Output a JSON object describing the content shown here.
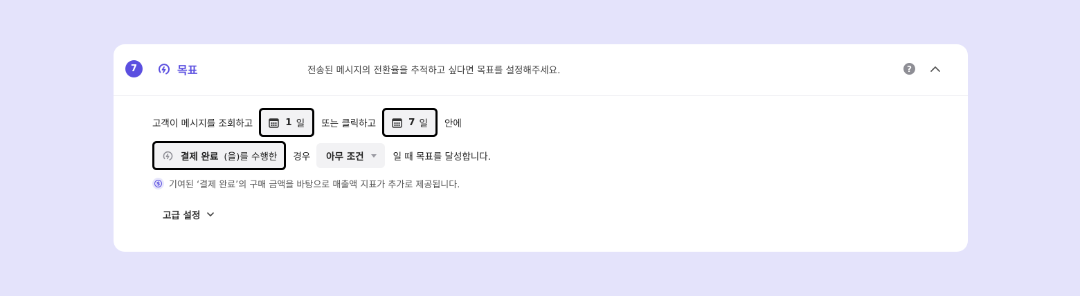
{
  "header": {
    "step_number": "7",
    "title": "목표",
    "description": "전송된 메시지의 전환율을 추적하고 싶다면 목표를 설정해주세요.",
    "help_label": "?"
  },
  "condition": {
    "prefix": "고객이 메시지를 조회하고",
    "view_days": "1",
    "day_unit": "일",
    "or_click": "또는 클릭하고",
    "click_days": "7",
    "within": "안에",
    "event_name": "결제 완료",
    "event_suffix": "(을)를 수행한",
    "case_label": "경우",
    "condition_value": "아무 조건",
    "goal_achieved": "일 때 목표를 달성합니다."
  },
  "info": {
    "icon_label": "$",
    "text": "기여된 ‘결제 완료’의 구매 금액을 바탕으로 매출액 지표가 추가로 제공됩니다."
  },
  "advanced": {
    "label": "고급 설정"
  },
  "colors": {
    "accent": "#5b4fe0",
    "background": "#e4e3fb"
  }
}
